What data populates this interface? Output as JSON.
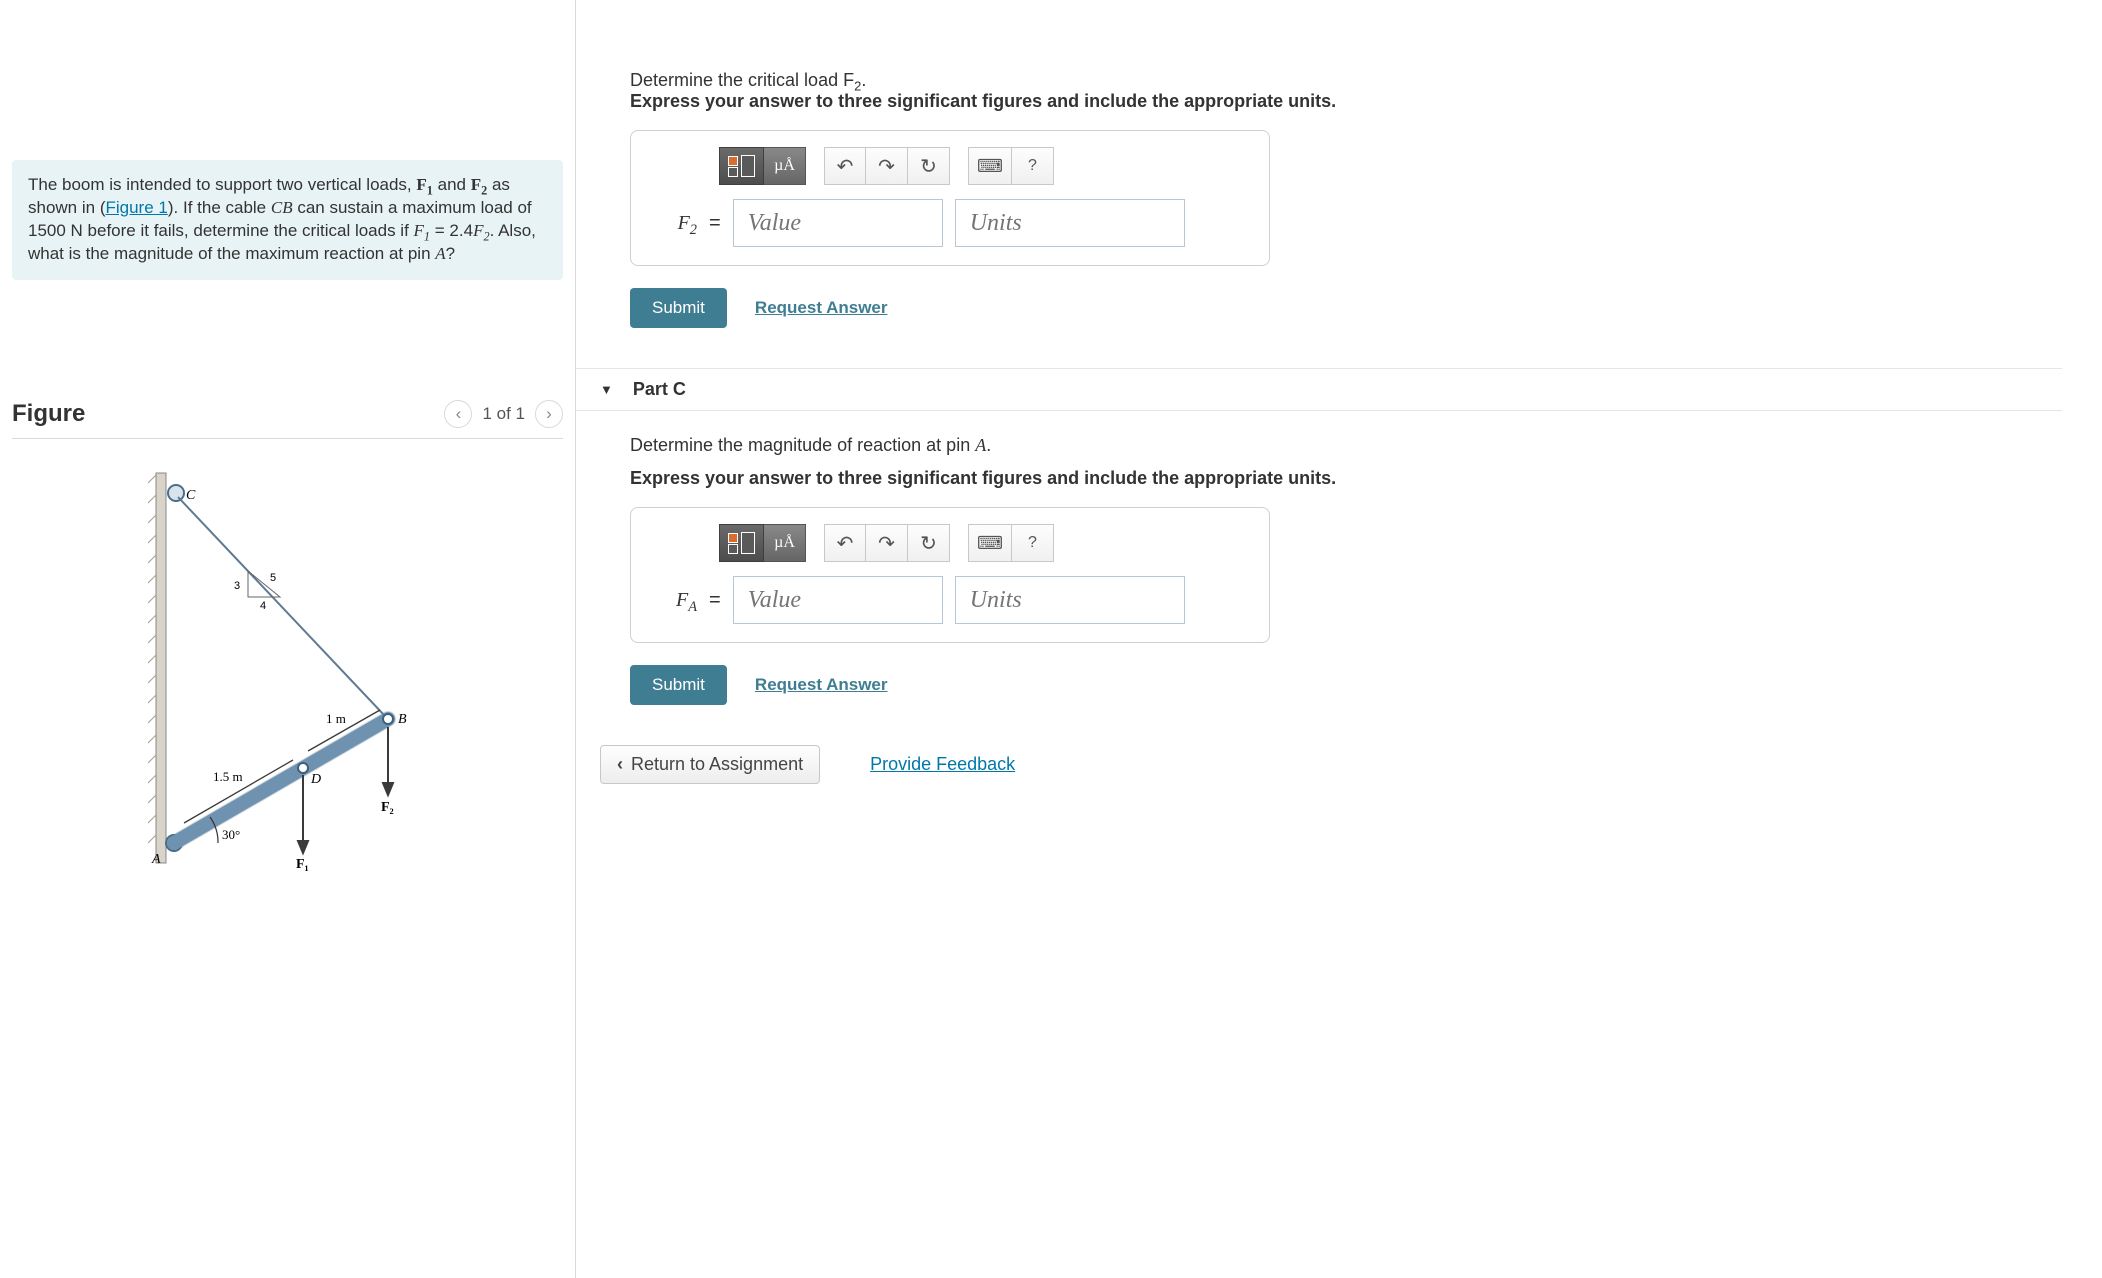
{
  "problem": {
    "text_1": "The boom is intended to support two vertical loads, ",
    "f1": "F",
    "f1_sub": "1",
    "and": " and ",
    "f2": "F",
    "f2_sub": "2",
    "text_2": " as shown in (",
    "figure_link": "Figure 1",
    "text_3": "). If the cable ",
    "cb": "CB",
    "text_4": " can sustain a maximum load of 1500 ",
    "n_unit": "N",
    "text_5": " before it fails, determine the critical loads if ",
    "eq_lhs": "F",
    "eq_lhs_sub": "1",
    "eq_mid": " = 2.4",
    "eq_rhs": "F",
    "eq_rhs_sub": "2",
    "text_6": ". Also, what is the magnitude of the maximum reaction at pin ",
    "pin_a": "A",
    "text_7": "?"
  },
  "figure": {
    "title": "Figure",
    "pager": "1 of 1",
    "labels": {
      "C": "C",
      "B": "B",
      "D": "D",
      "A": "A",
      "F1": "F₁",
      "F2": "F₂",
      "d1": "1.5 m",
      "d2": "1 m",
      "ang": "30°",
      "t3": "3",
      "t4": "4",
      "t5": "5"
    }
  },
  "partB": {
    "cutoff_prompt": "Determine the critical load ",
    "cutoff_var": "F",
    "cutoff_sub": "2",
    "cutoff_end": ".",
    "instruction": "Express your answer to three significant figures and include the appropriate units.",
    "label": "F",
    "label_sub": "2",
    "value_placeholder": "Value",
    "units_placeholder": "Units",
    "submit": "Submit",
    "request": "Request Answer"
  },
  "partC": {
    "title": "Part C",
    "prompt": "Determine the magnitude of reaction at pin ",
    "prompt_var": "A",
    "prompt_end": ".",
    "instruction": "Express your answer to three significant figures and include the appropriate units.",
    "label": "F",
    "label_sub": "A",
    "value_placeholder": "Value",
    "units_placeholder": "Units",
    "submit": "Submit",
    "request": "Request Answer"
  },
  "toolbar": {
    "ma": "µÅ",
    "help": "?"
  },
  "bottom": {
    "return": "Return to Assignment",
    "feedback": "Provide Feedback"
  }
}
